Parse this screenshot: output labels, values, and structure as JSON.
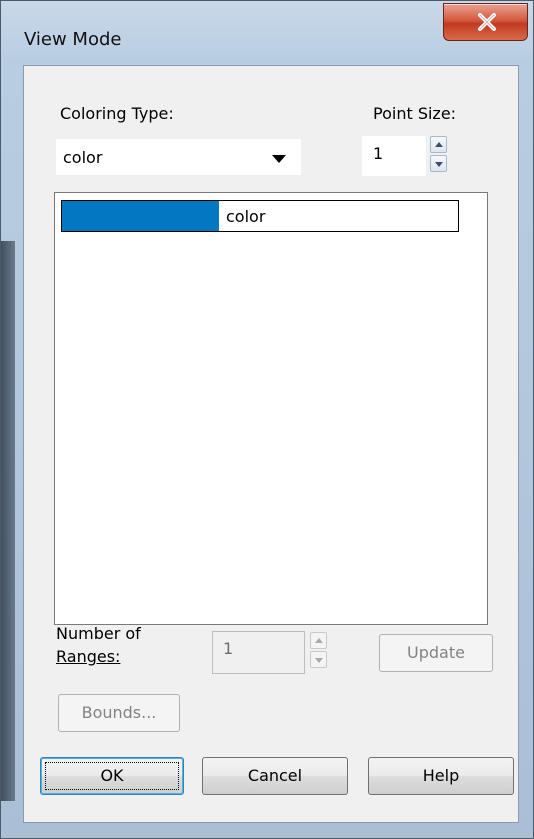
{
  "window": {
    "title": "View Mode"
  },
  "coloring_type": {
    "label": "Coloring Type:",
    "value": "color"
  },
  "point_size": {
    "label": "Point Size:",
    "value": "1"
  },
  "color_list": {
    "items": [
      {
        "label": "color",
        "swatch_color": "#0377c1"
      }
    ]
  },
  "ranges": {
    "label_line1": "Number of",
    "label_line2": "Ranges:",
    "value": "1"
  },
  "buttons": {
    "update": "Update",
    "bounds": "Bounds...",
    "ok": "OK",
    "cancel": "Cancel",
    "help": "Help"
  }
}
